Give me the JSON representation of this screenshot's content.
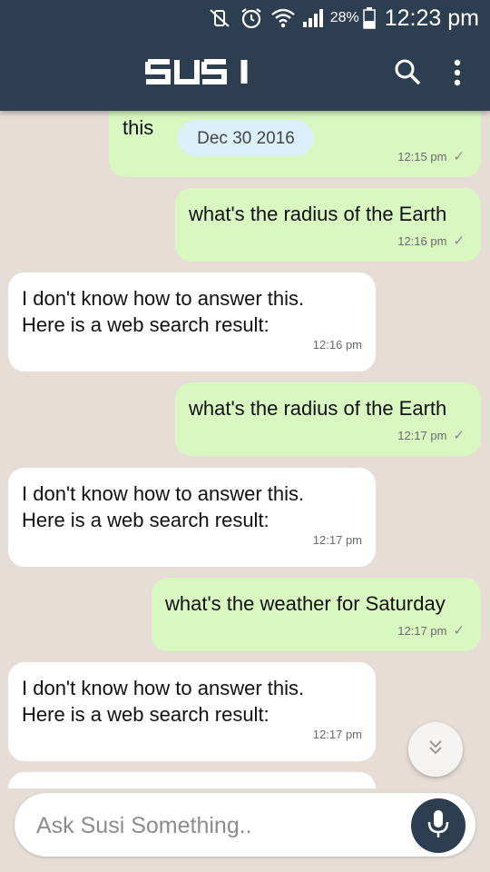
{
  "status_bar": {
    "battery_percent": "28%",
    "time": "12:23 pm",
    "icons": [
      "vibrate-off-icon",
      "alarm-icon",
      "wifi-icon",
      "signal-icon",
      "battery-icon"
    ]
  },
  "app_bar": {
    "logo_text": "SUSI",
    "background": "#2c3e50",
    "icons": [
      "search-icon",
      "more-vert-icon"
    ]
  },
  "messages": [
    {
      "from": "user",
      "text": "this",
      "date_chip": "Dec 30 2016",
      "time": "12:15 pm",
      "status": "✓"
    },
    {
      "from": "user",
      "text": "what's the radius of the Earth",
      "time": "12:16 pm",
      "status": "✓"
    },
    {
      "from": "bot",
      "text": "I don't know how to answer this.\nHere is a web search result:",
      "time": "12:16 pm"
    },
    {
      "from": "user",
      "text": "what's the radius of the Earth",
      "time": "12:17 pm",
      "status": "✓"
    },
    {
      "from": "bot",
      "text": "I don't know how to answer this.\nHere is a web search result:",
      "time": "12:17 pm"
    },
    {
      "from": "user",
      "text": "what's the weather for Saturday",
      "time": "12:17 pm",
      "status": "✓"
    },
    {
      "from": "bot",
      "text": "I don't know how to answer this.\nHere is a web search result:",
      "time": "12:17 pm"
    }
  ],
  "composer": {
    "placeholder": "Ask Susi Something..",
    "value": "",
    "mic_icon": "mic-icon",
    "scroll_down_icon": "chevron-double-down-icon"
  },
  "colors": {
    "user_bubble": "#d8f7c1",
    "bot_bubble": "#ffffff",
    "chat_background": "#e6ddd6",
    "accent": "#2c3e50"
  }
}
